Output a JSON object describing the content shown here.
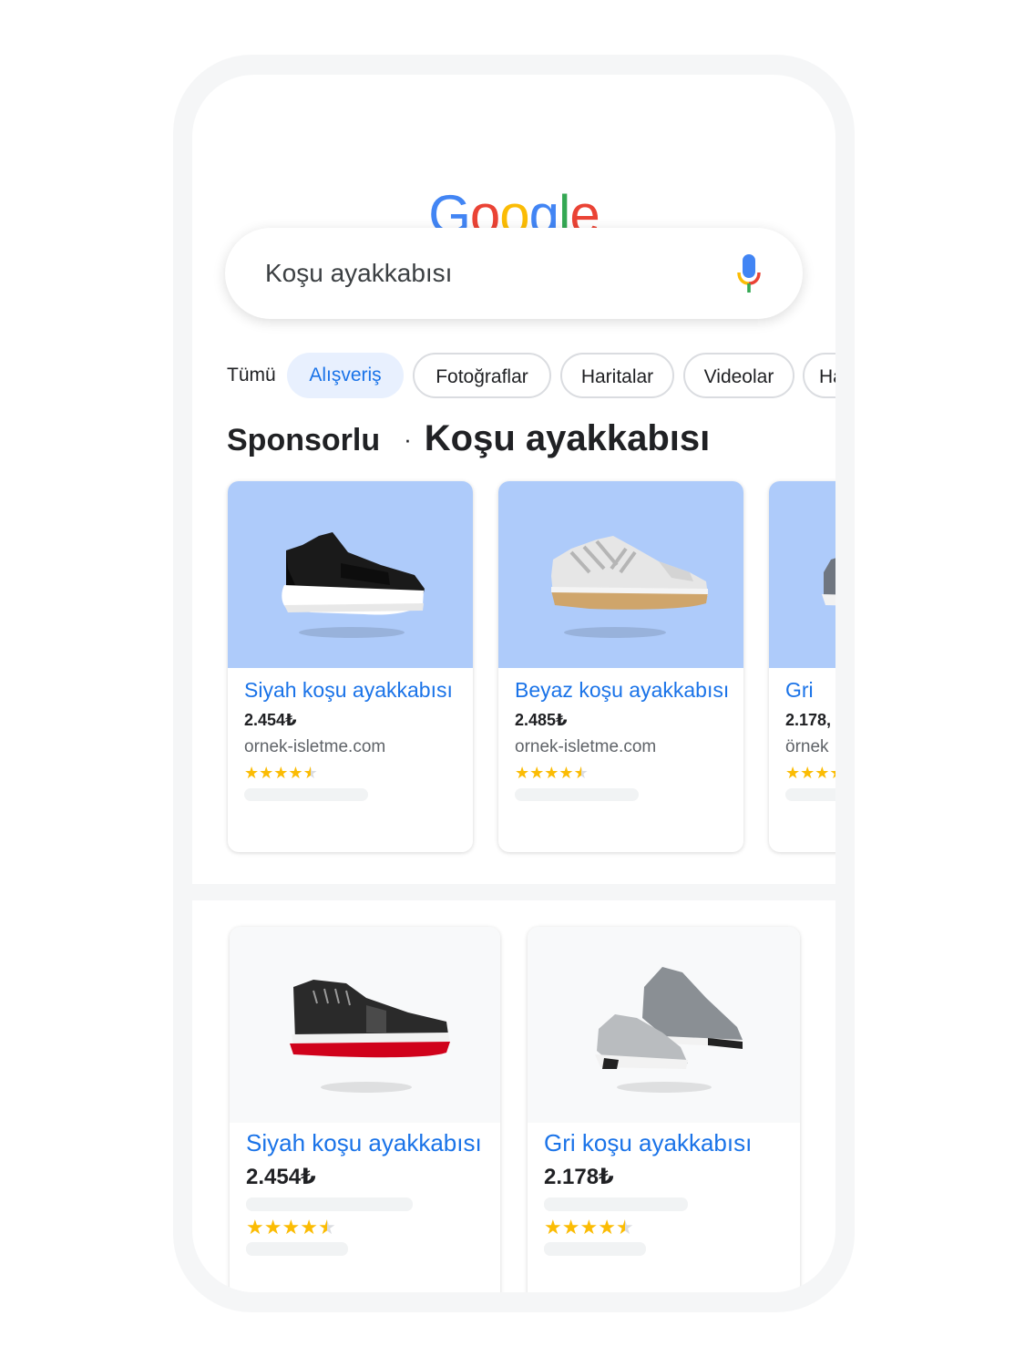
{
  "logo": {
    "letters": [
      {
        "char": "G",
        "color": "#4285f4"
      },
      {
        "char": "o",
        "color": "#ea4335"
      },
      {
        "char": "o",
        "color": "#fbbc05"
      },
      {
        "char": "g",
        "color": "#4285f4"
      },
      {
        "char": "l",
        "color": "#34a853"
      },
      {
        "char": "e",
        "color": "#ea4335"
      }
    ]
  },
  "search": {
    "query": "Koşu ayakkabısı",
    "mic_icon": "microphone-icon"
  },
  "chips": [
    "Tümü",
    "Alışveriş",
    "Fotoğraflar",
    "Haritalar",
    "Videolar",
    "Ha"
  ],
  "active_chip": "Alışveriş",
  "section": {
    "sponsored": "Sponsorlu",
    "separator": "·",
    "title": "Koşu ayakkabısı"
  },
  "sponsored_products": [
    {
      "title": "Siyah koşu ayakkabısı",
      "price": "2.454₺",
      "site": "ornek-isletme.com",
      "rating": 4.5,
      "image": "black-slip-on-sneaker"
    },
    {
      "title": "Beyaz koşu ayakkabısı",
      "price": "2.485₺",
      "site": "ornek-isletme.com",
      "rating": 4.5,
      "image": "white-sneaker"
    },
    {
      "title": "Gri",
      "price": "2.178,",
      "site": "örnek",
      "rating": 4.5,
      "image": "grey-sneaker"
    }
  ],
  "products": [
    {
      "title": "Siyah koşu ayakkabısı",
      "price": "2.454₺",
      "rating": 4.5,
      "image": "black-red-running-shoe"
    },
    {
      "title": "Gri koşu ayakkabısı",
      "price": "2.178₺",
      "rating": 4.5,
      "image": "grey-running-shoes-pair"
    }
  ],
  "colors": {
    "accent": "#1a73e8",
    "star": "#fbbc04",
    "card_image_bg": "#aecbfa"
  }
}
